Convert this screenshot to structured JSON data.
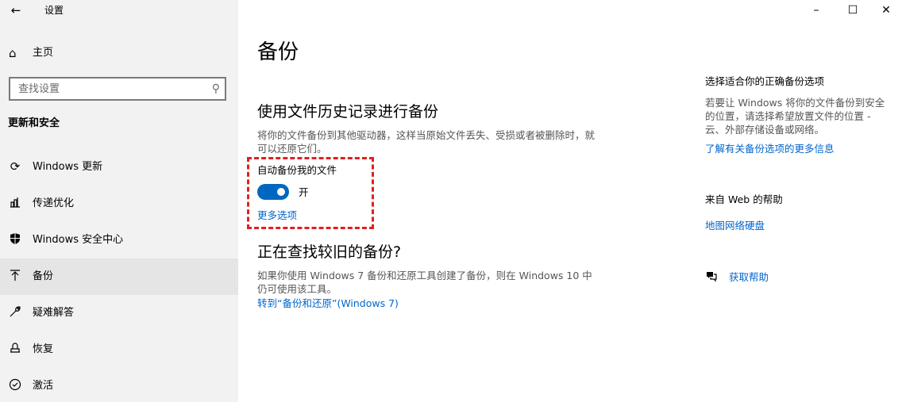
{
  "window": {
    "title": "设置",
    "controls": {
      "minimize": "–",
      "maximize": "☐",
      "close": "✕"
    }
  },
  "sidebar": {
    "back_glyph": "←",
    "home": {
      "icon": "home-icon",
      "label": "主页"
    },
    "search": {
      "placeholder": "查找设置",
      "value": "",
      "icon": "search-icon"
    },
    "section_title": "更新和安全",
    "items": [
      {
        "icon": "sync-icon",
        "label": "Windows 更新",
        "selected": false
      },
      {
        "icon": "delivery-optimization-icon",
        "label": "传递优化",
        "selected": false
      },
      {
        "icon": "shield-icon",
        "label": "Windows 安全中心",
        "selected": false
      },
      {
        "icon": "backup-upload-icon",
        "label": "备份",
        "selected": true
      },
      {
        "icon": "wrench-icon",
        "label": "疑难解答",
        "selected": false
      },
      {
        "icon": "recovery-icon",
        "label": "恢复",
        "selected": false
      },
      {
        "icon": "activation-check-icon",
        "label": "激活",
        "selected": false
      }
    ]
  },
  "main": {
    "title": "备份",
    "file_history": {
      "heading": "使用文件历史记录进行备份",
      "description": "将你的文件备份到其他驱动器，这样当原始文件丢失、受损或者被删除时，就可以还原它们。",
      "toggle_label": "自动备份我的文件",
      "toggle_state": "开",
      "toggle_on": true,
      "more_options": "更多选项"
    },
    "older_backup": {
      "heading": "正在查找较旧的备份?",
      "description": "如果你使用 Windows 7 备份和还原工具创建了备份，则在 Windows 10 中仍可使用该工具。",
      "link": "转到“备份和还原”(Windows 7)"
    }
  },
  "right": {
    "choose_title": "选择适合你的正确备份选项",
    "choose_desc": "若要让 Windows 将你的文件备份到安全的位置，请选择希望放置文件的位置 - 云、外部存储设备或网络。",
    "learn_more": "了解有关备份选项的更多信息",
    "web_help_title": "来自 Web 的帮助",
    "web_help_link": "地图网络硬盘",
    "get_help": "获取帮助",
    "get_help_icon": "chat-help-icon"
  },
  "colors": {
    "accent": "#0067c0",
    "link": "#0066cc",
    "highlight_box": "#e02020",
    "sidebar_bg": "#f2f2f2",
    "selected_bg": "#e5e5e5"
  }
}
